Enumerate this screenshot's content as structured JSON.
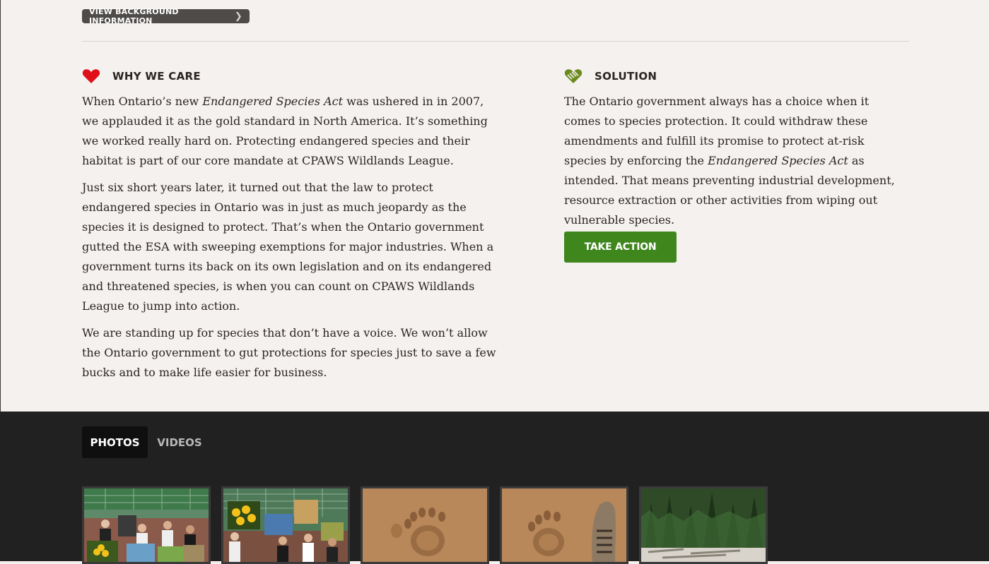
{
  "background_button": {
    "label": "VIEW BACKGROUND INFORMATION"
  },
  "why_we_care": {
    "heading": "WHY WE CARE",
    "icon": "heart-icon",
    "p1": {
      "a": "When Ontario’s new ",
      "em": "Endangered Species Act",
      "b": " was ushered in in 2007, we applauded it as the gold standard in North America. It’s something we worked really hard on. Protecting endangered species and their habitat is part of our core mandate at CPAWS Wildlands League."
    },
    "p2": "Just six short years later, it turned out that the law to protect endangered species in Ontario was in just as much jeopardy as the species it is designed to protect. That’s when the Ontario government gutted the ESA with sweeping exemptions for major industries. When a government turns its back on its own legislation and on its endangered and threatened species, is when you can count on CPAWS Wildlands League to jump into action.",
    "p3": "We are standing up for species that don’t have a voice. We won’t allow the Ontario government to gut protections for species just to save a few bucks and to make life easier for business."
  },
  "solution": {
    "heading": "SOLUTION",
    "icon": "handshake-icon",
    "p1": {
      "a": "The Ontario government always has a choice when it comes to species protection. It could withdraw these amendments and fulfill its promise to protect at-risk species by enforcing the ",
      "em": "Endangered Species Act",
      "b": " as intended. That means preventing industrial development, resource extraction or other activities from wiping out vulnerable species."
    },
    "button": "TAKE ACTION"
  },
  "media": {
    "tabs": [
      "PHOTOS",
      "VIDEOS"
    ],
    "active_tab": "PHOTOS",
    "thumbnails": [
      "photo-thumbnail-press-event-1",
      "photo-thumbnail-press-event-2",
      "photo-thumbnail-bear-track",
      "photo-thumbnail-bear-track-boot",
      "photo-thumbnail-forest-shore"
    ]
  },
  "colors": {
    "accent_green": "#3f861d",
    "heart_red": "#e0101a",
    "handshake_green": "#6a8a1e",
    "dark_section": "#212121"
  }
}
